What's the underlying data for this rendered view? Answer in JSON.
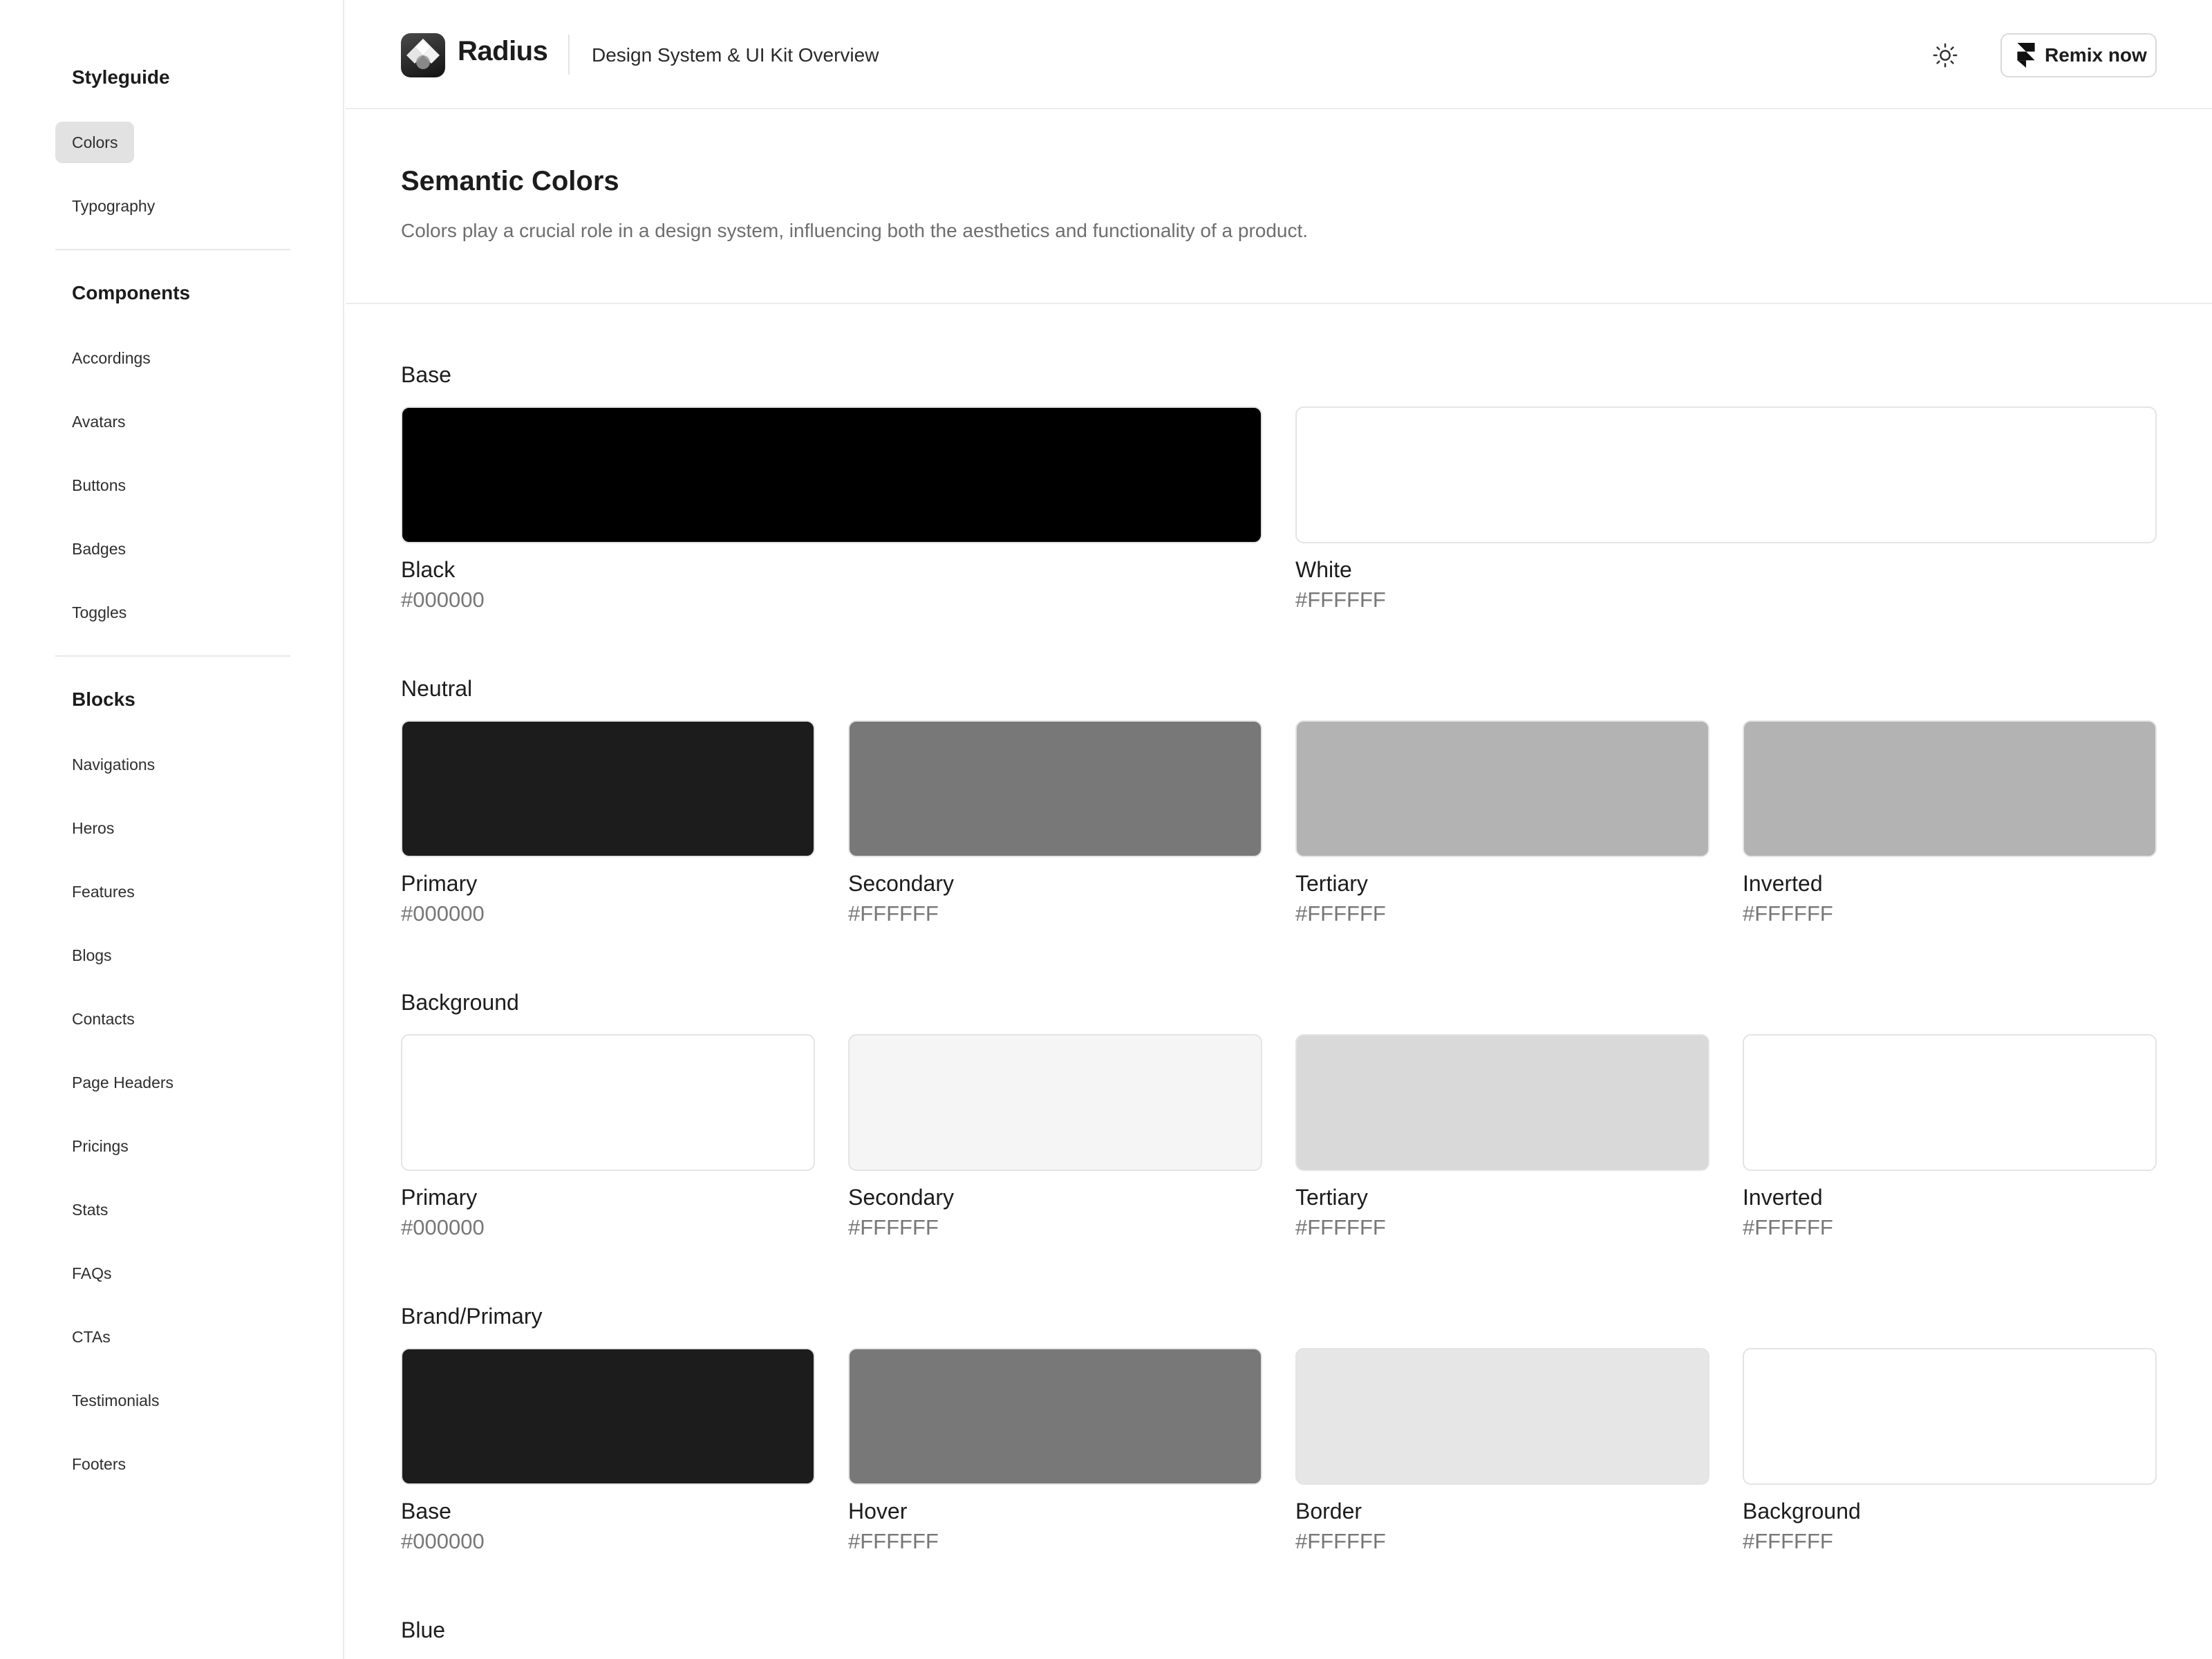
{
  "sidebar": {
    "groups": [
      {
        "heading": "Styleguide",
        "items": [
          "Colors",
          "Typography"
        ]
      },
      {
        "heading": "Components",
        "items": [
          "Accordings",
          "Avatars",
          "Buttons",
          "Badges",
          "Toggles"
        ]
      },
      {
        "heading": "Blocks",
        "items": [
          "Navigations",
          "Heros",
          "Features",
          "Blogs",
          "Contacts",
          "Page Headers",
          "Pricings",
          "Stats",
          "FAQs",
          "CTAs",
          "Testimonials",
          "Footers"
        ]
      }
    ],
    "active_item": "Colors"
  },
  "header": {
    "brand": "Radius",
    "subtitle": "Design System & UI Kit Overview",
    "theme_icon": "sun-icon",
    "remix_label": "Remix now",
    "remix_icon": "framer-icon"
  },
  "intro": {
    "title": "Semantic Colors",
    "description": "Colors play a crucial role in a design system, influencing both the aesthetics and functionality of a product."
  },
  "sections": [
    {
      "label": "Base",
      "swatches": [
        {
          "name": "Black",
          "hex": "#000000",
          "color": "#000000"
        },
        {
          "name": "White",
          "hex": "#FFFFFF",
          "color": "#ffffff"
        }
      ]
    },
    {
      "label": "Neutral",
      "swatches": [
        {
          "name": "Primary",
          "hex": "#000000",
          "color": "#1c1c1c"
        },
        {
          "name": "Secondary",
          "hex": "#FFFFFF",
          "color": "#787878"
        },
        {
          "name": "Tertiary",
          "hex": "#FFFFFF",
          "color": "#b3b3b3"
        },
        {
          "name": "Inverted",
          "hex": "#FFFFFF",
          "color": "#b3b3b3"
        }
      ]
    },
    {
      "label": "Background",
      "swatches": [
        {
          "name": "Primary",
          "hex": "#000000",
          "color": "#ffffff"
        },
        {
          "name": "Secondary",
          "hex": "#FFFFFF",
          "color": "#f5f5f5"
        },
        {
          "name": "Tertiary",
          "hex": "#FFFFFF",
          "color": "#d9d9d9"
        },
        {
          "name": "Inverted",
          "hex": "#FFFFFF",
          "color": "#ffffff"
        }
      ]
    },
    {
      "label": "Brand/Primary",
      "swatches": [
        {
          "name": "Base",
          "hex": "#000000",
          "color": "#1c1c1c"
        },
        {
          "name": "Hover",
          "hex": "#FFFFFF",
          "color": "#787878"
        },
        {
          "name": "Border",
          "hex": "#FFFFFF",
          "color": "#e6e6e6"
        },
        {
          "name": "Background",
          "hex": "#FFFFFF",
          "color": "#ffffff"
        }
      ]
    },
    {
      "label": "Blue",
      "swatches": []
    }
  ]
}
